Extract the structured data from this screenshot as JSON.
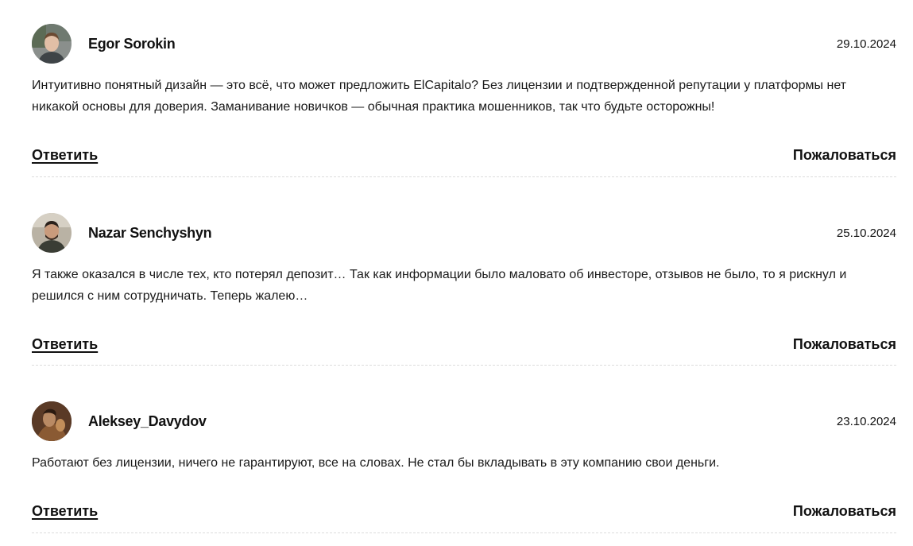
{
  "comments": [
    {
      "author": "Egor Sorokin",
      "date": "29.10.2024",
      "text": "Интуитивно понятный дизайн — это всё, что может предложить ElCapitalo? Без лицензии и подтвержденной репутации у платформы нет никакой основы для доверия. Заманивание новичков — обычная практика мошенников, так что будьте осторожны!",
      "reply_label": "Ответить",
      "report_label": "Пожаловаться"
    },
    {
      "author": "Nazar Senchyshyn",
      "date": "25.10.2024",
      "text": "Я также оказался в числе тех, кто потерял депозит… Так как информации было маловато об инвесторе, отзывов не было, то я рискнул и решился с ним сотрудничать. Теперь жалею…",
      "reply_label": "Ответить",
      "report_label": "Пожаловаться"
    },
    {
      "author": "Aleksey_Davydov",
      "date": "23.10.2024",
      "text": "Работают без лицензии, ничего не гарантируют, все на словах. Не стал бы вкладывать в эту компанию свои деньги.",
      "reply_label": "Ответить",
      "report_label": "Пожаловаться"
    }
  ]
}
